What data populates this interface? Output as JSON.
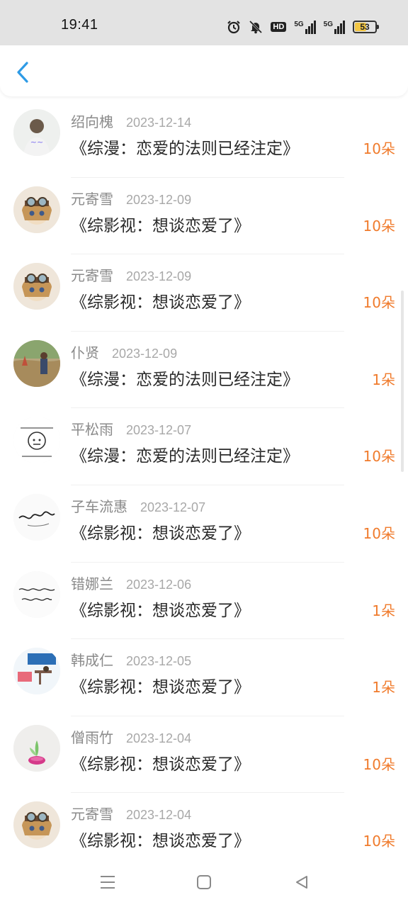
{
  "status_bar": {
    "time": "19:41",
    "signal1_label": "5G",
    "signal2_label": "5G",
    "hd_label": "HD",
    "battery_level": "53",
    "battery_fraction": 0.53,
    "icons": [
      "alarm-icon",
      "mute-icon",
      "hd-icon",
      "signal-icon",
      "signal-icon",
      "battery-icon"
    ]
  },
  "header": {
    "back_icon": "chevron-left-icon",
    "accent_color": "#2e9be6"
  },
  "list": {
    "accent_color": "#f07b2c",
    "items": [
      {
        "name": "绍向槐",
        "date": "2023-12-14",
        "title": "《综漫：恋爱的法则已经注定》",
        "count": "10朵",
        "avatar": "avatar-person-photo"
      },
      {
        "name": "元寄雪",
        "date": "2023-12-09",
        "title": "《综影视：想谈恋爱了》",
        "count": "10朵",
        "avatar": "avatar-anime-girl"
      },
      {
        "name": "元寄雪",
        "date": "2023-12-09",
        "title": "《综影视：想谈恋爱了》",
        "count": "10朵",
        "avatar": "avatar-anime-girl"
      },
      {
        "name": "仆贤",
        "date": "2023-12-09",
        "title": "《综漫：恋爱的法则已经注定》",
        "count": "1朵",
        "avatar": "avatar-outdoor-photo"
      },
      {
        "name": "平松雨",
        "date": "2023-12-07",
        "title": "《综漫：恋爱的法则已经注定》",
        "count": "10朵",
        "avatar": "avatar-cartoon-sketch"
      },
      {
        "name": "子车流惠",
        "date": "2023-12-07",
        "title": "《综影视：想谈恋爱了》",
        "count": "10朵",
        "avatar": "avatar-calligraphy"
      },
      {
        "name": "错娜兰",
        "date": "2023-12-06",
        "title": "《综影视：想谈恋爱了》",
        "count": "1朵",
        "avatar": "avatar-handwriting"
      },
      {
        "name": "韩成仁",
        "date": "2023-12-05",
        "title": "《综影视：想谈恋爱了》",
        "count": "1朵",
        "avatar": "avatar-poster"
      },
      {
        "name": "僧雨竹",
        "date": "2023-12-04",
        "title": "《综影视：想谈恋爱了》",
        "count": "10朵",
        "avatar": "avatar-plant"
      },
      {
        "name": "元寄雪",
        "date": "2023-12-04",
        "title": "《综影视：想谈恋爱了》",
        "count": "10朵",
        "avatar": "avatar-anime-girl"
      }
    ]
  },
  "nav_bar": {
    "icons": [
      "menu-icon",
      "home-square-icon",
      "back-triangle-icon"
    ]
  }
}
